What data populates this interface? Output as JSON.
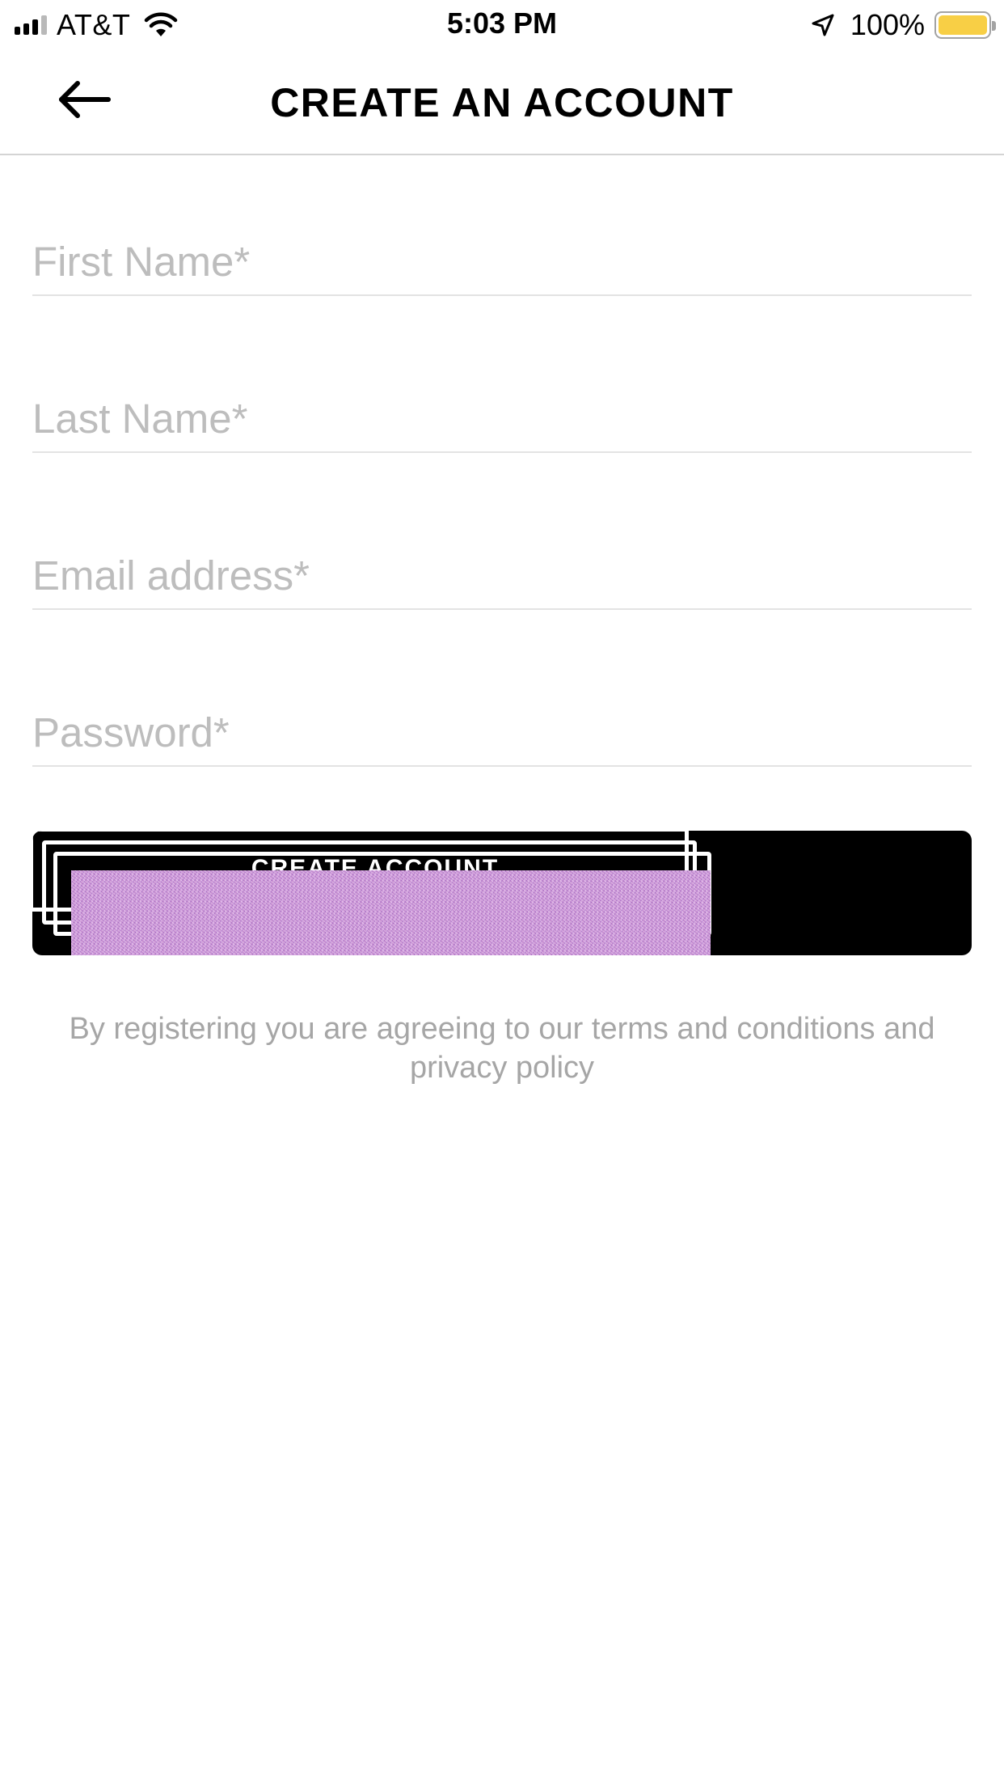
{
  "status_bar": {
    "carrier": "AT&T",
    "time": "5:03 PM",
    "battery_percent": "100%",
    "battery_color": "#f8cf45",
    "icons": [
      "signal-icon",
      "wifi-icon",
      "location-arrow-icon",
      "battery-icon"
    ]
  },
  "nav": {
    "back_icon": "arrow-left-icon",
    "title": "CREATE AN ACCOUNT"
  },
  "form": {
    "first_name": {
      "placeholder": "First Name*",
      "value": ""
    },
    "last_name": {
      "placeholder": "Last Name*",
      "value": ""
    },
    "email": {
      "placeholder": "Email address*",
      "value": ""
    },
    "password": {
      "placeholder": "Password*",
      "value": ""
    },
    "submit_label": "CREATE ACCOUNT",
    "submit_color": "#000000"
  },
  "terms_text": "By registering you are agreeing to our terms and conditions and privacy policy"
}
